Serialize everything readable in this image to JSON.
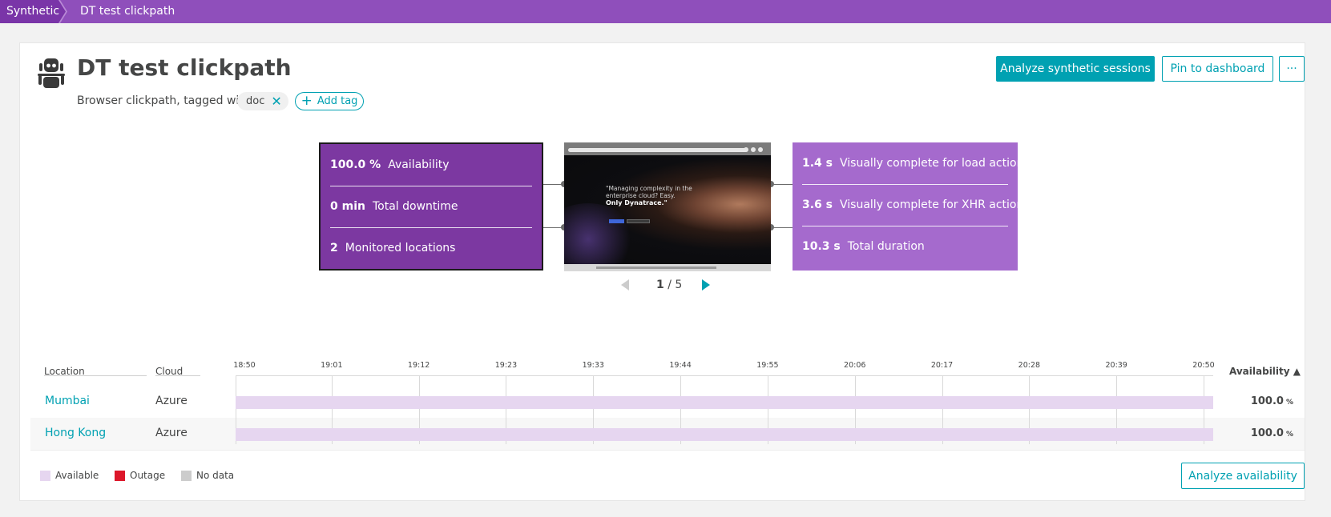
{
  "breadcrumb": {
    "root": "Synthetic",
    "current": "DT test clickpath"
  },
  "header": {
    "title": "DT test clickpath",
    "subtitle": "Browser clickpath, tagged with",
    "tag": "doc",
    "add_tag": "Add tag"
  },
  "actions": {
    "analyze_sessions": "Analyze synthetic sessions",
    "pin": "Pin to dashboard",
    "more": "···",
    "analyze_availability": "Analyze availability"
  },
  "metrics_left": [
    {
      "value": "100.0 %",
      "label": "Availability"
    },
    {
      "value": "0 min",
      "label": "Total downtime"
    },
    {
      "value": "2",
      "label": "Monitored locations"
    }
  ],
  "metrics_right": [
    {
      "value": "1.4 s",
      "label": "Visually complete for load actions"
    },
    {
      "value": "3.6 s",
      "label": "Visually complete for XHR actions"
    },
    {
      "value": "10.3 s",
      "label": "Total duration"
    }
  ],
  "screenshot_preview": {
    "headline": "\"Managing complexity in the enterprise cloud? Easy.",
    "headline_strong": "Only Dynatrace.\""
  },
  "pager": {
    "current": "1",
    "total": "/ 5"
  },
  "table": {
    "col_location": "Location",
    "col_cloud": "Cloud",
    "col_availability": "Availability ▲",
    "ticks": [
      "18:50",
      "19:01",
      "19:12",
      "19:23",
      "19:33",
      "19:44",
      "19:55",
      "20:06",
      "20:17",
      "20:28",
      "20:39",
      "20:50"
    ],
    "rows": [
      {
        "location": "Mumbai",
        "cloud": "Azure",
        "availability": "100.0",
        "unit": "%",
        "available_fraction": 1.0
      },
      {
        "location": "Hong Kong",
        "cloud": "Azure",
        "availability": "100.0",
        "unit": "%",
        "available_fraction": 1.0
      }
    ]
  },
  "legend": {
    "available": "Available",
    "available_color": "#e6d6f0",
    "outage": "Outage",
    "outage_color": "#dc172a",
    "nodata": "No data",
    "nodata_color": "#cccccc"
  },
  "colors": {
    "accent": "#00a1b2",
    "topbar": "#8f4fbb",
    "metric_left": "#7c38a1",
    "metric_right": "#a56acd"
  }
}
